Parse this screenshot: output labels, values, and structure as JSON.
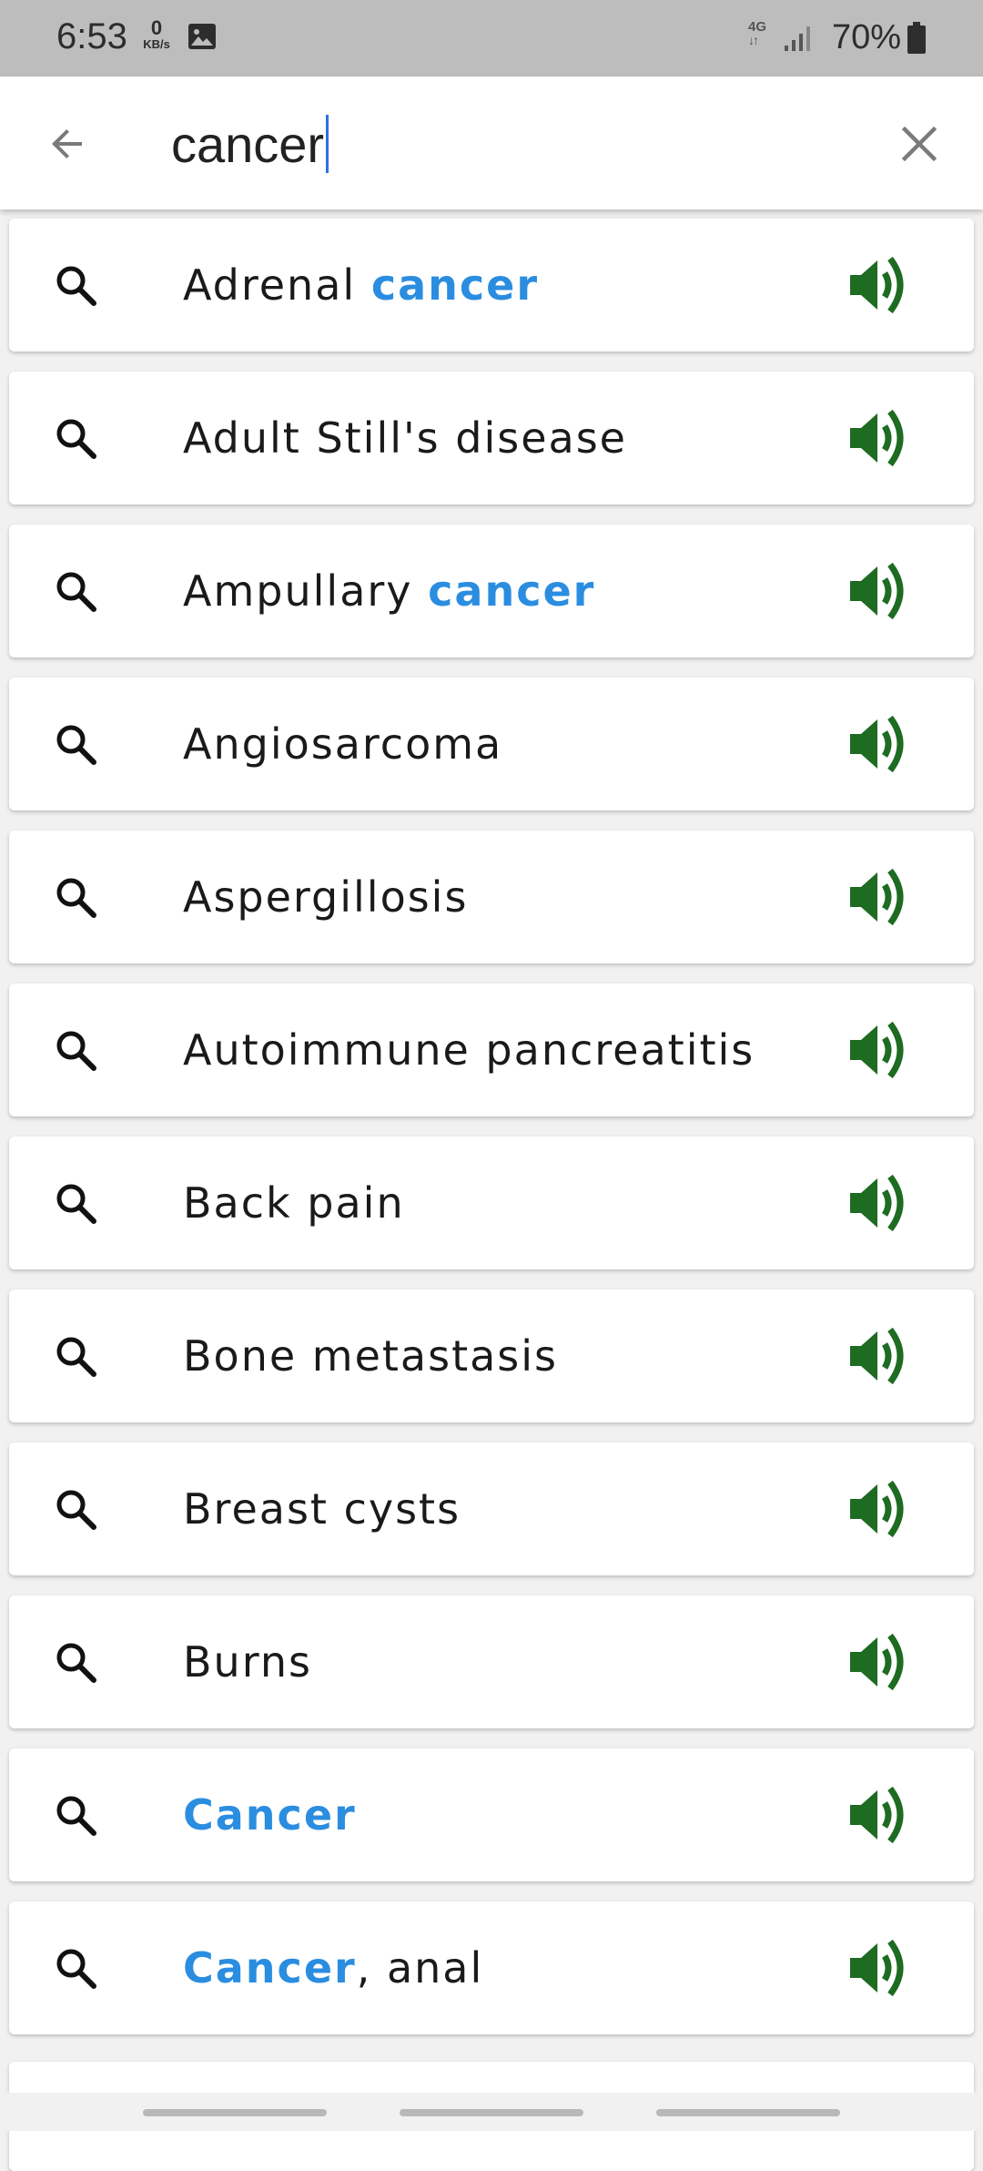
{
  "status_bar": {
    "time": "6:53",
    "net_speed_value": "0",
    "net_speed_unit": "KB/s",
    "network_type": "4G",
    "battery_percent": "70%"
  },
  "search": {
    "query": "cancer",
    "highlight_color": "#2b8de0"
  },
  "results": [
    {
      "parts": [
        {
          "text": "Adrenal ",
          "hl": false
        },
        {
          "text": "cancer",
          "hl": true
        }
      ]
    },
    {
      "parts": [
        {
          "text": "Adult Still's disease",
          "hl": false
        }
      ]
    },
    {
      "parts": [
        {
          "text": "Ampullary ",
          "hl": false
        },
        {
          "text": "cancer",
          "hl": true
        }
      ]
    },
    {
      "parts": [
        {
          "text": "Angiosarcoma",
          "hl": false
        }
      ]
    },
    {
      "parts": [
        {
          "text": "Aspergillosis",
          "hl": false
        }
      ]
    },
    {
      "parts": [
        {
          "text": "Autoimmune pancreatitis",
          "hl": false
        }
      ]
    },
    {
      "parts": [
        {
          "text": "Back pain",
          "hl": false
        }
      ]
    },
    {
      "parts": [
        {
          "text": "Bone metastasis",
          "hl": false
        }
      ]
    },
    {
      "parts": [
        {
          "text": "Breast cysts",
          "hl": false
        }
      ]
    },
    {
      "parts": [
        {
          "text": "Burns",
          "hl": false
        }
      ]
    },
    {
      "parts": [
        {
          "text": "Cancer",
          "hl": true
        }
      ]
    },
    {
      "parts": [
        {
          "text": "Cancer",
          "hl": true
        },
        {
          "text": ", anal",
          "hl": false
        }
      ]
    }
  ],
  "icons": {
    "result_leading": "search-icon",
    "result_trailing": "speaker-icon",
    "speaker_color": "#1e6b22"
  }
}
